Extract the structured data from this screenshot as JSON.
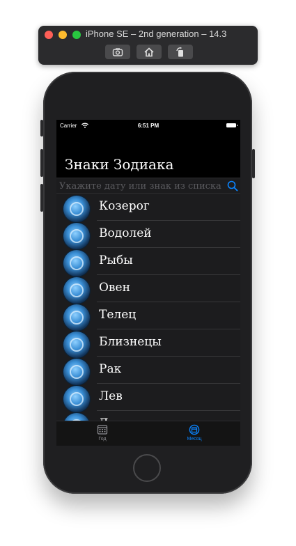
{
  "simulator": {
    "title": "iPhone SE – 2nd generation – 14.3",
    "buttons": [
      "screenshot-icon",
      "home-icon",
      "rotate-icon"
    ]
  },
  "status": {
    "carrier": "Carrier",
    "time": "6:51 PM"
  },
  "nav": {
    "title": "Знаки Зодиака"
  },
  "search": {
    "placeholder": "Укажите дату или знак из списка",
    "value": ""
  },
  "signs": [
    {
      "label": "Козерог",
      "icon": "capricorn-icon"
    },
    {
      "label": "Водолей",
      "icon": "aquarius-icon"
    },
    {
      "label": "Рыбы",
      "icon": "pisces-icon"
    },
    {
      "label": "Овен",
      "icon": "aries-icon"
    },
    {
      "label": "Телец",
      "icon": "taurus-icon"
    },
    {
      "label": "Близнецы",
      "icon": "gemini-icon"
    },
    {
      "label": "Рак",
      "icon": "cancer-icon"
    },
    {
      "label": "Лев",
      "icon": "leo-icon"
    },
    {
      "label": "Дева",
      "icon": "virgo-icon"
    }
  ],
  "tabs": [
    {
      "label": "Год",
      "icon": "calendar-grid-icon",
      "selected": false
    },
    {
      "label": "Месяц",
      "icon": "calendar-circle-icon",
      "selected": true
    }
  ],
  "colors": {
    "accent": "#0a84ff",
    "background": "#000000",
    "list_background": "#1c1c1e"
  }
}
